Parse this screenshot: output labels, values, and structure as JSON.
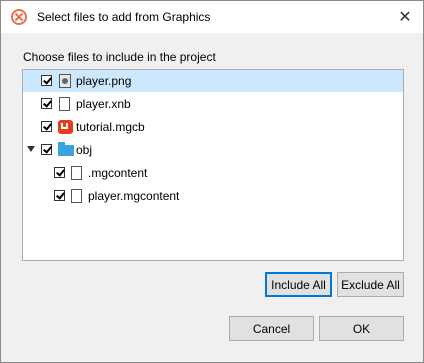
{
  "dialog": {
    "title": "Select files to add from Graphics",
    "close_glyph": "✕",
    "instruction": "Choose files to include in the project"
  },
  "tree": {
    "items": [
      {
        "label": "player.png",
        "icon": "image-file-icon",
        "checked": true,
        "selected": true
      },
      {
        "label": "player.xnb",
        "icon": "file-icon",
        "checked": true,
        "selected": false
      },
      {
        "label": "tutorial.mgcb",
        "icon": "monogame-icon",
        "checked": true,
        "selected": false
      },
      {
        "label": "obj",
        "icon": "folder-icon",
        "checked": true,
        "expanded": true,
        "selected": false
      },
      {
        "label": ".mgcontent",
        "icon": "file-icon",
        "checked": true,
        "selected": false
      },
      {
        "label": "player.mgcontent",
        "icon": "file-icon",
        "checked": true,
        "selected": false
      }
    ]
  },
  "buttons": {
    "include_all": "Include All",
    "exclude_all": "Exclude All",
    "cancel": "Cancel",
    "ok": "OK"
  },
  "colors": {
    "selection": "#cce8ff",
    "accent": "#0078d7",
    "folder": "#3aa3d9",
    "monogame": "#e73c1e"
  }
}
